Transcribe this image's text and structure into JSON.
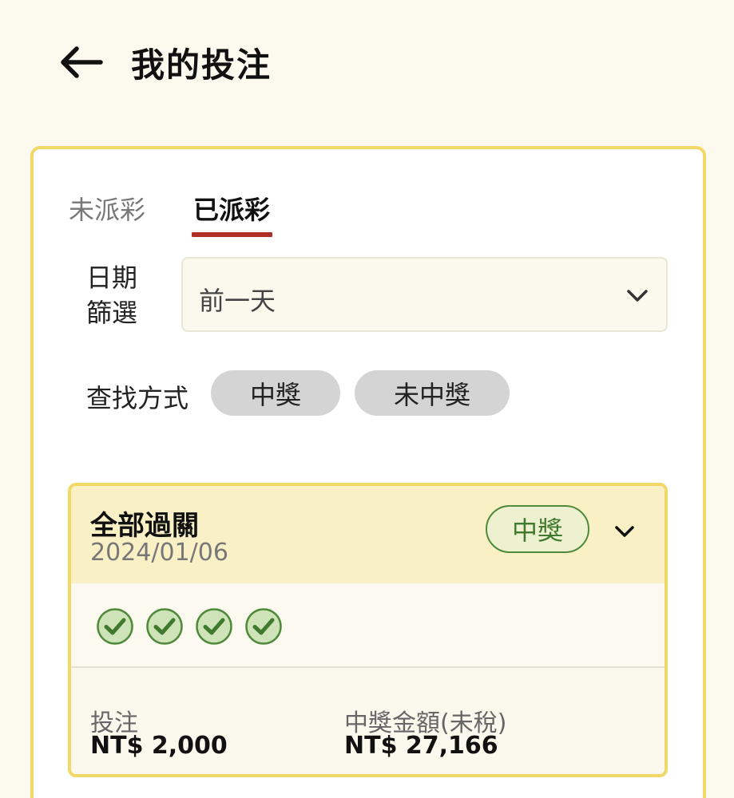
{
  "header": {
    "title": "我的投注",
    "back_icon": "arrow-left-icon"
  },
  "tabs": [
    {
      "label": "未派彩",
      "active": false
    },
    {
      "label": "已派彩",
      "active": true
    }
  ],
  "colors": {
    "accent_yellow": "#f2d867",
    "tab_underline": "#b03028",
    "win_green": "#4f8a3a"
  },
  "filter": {
    "date_label": "日期篩選",
    "date_value": "前一天",
    "search_label": "查找方式",
    "options": [
      "中獎",
      "未中獎"
    ]
  },
  "bet": {
    "type": "全部過關",
    "date": "2024/01/06",
    "status": "中獎",
    "legs": [
      "won",
      "won",
      "won",
      "won"
    ],
    "stake_label": "投注",
    "stake_value": "NT$ 2,000",
    "payout_label": "中獎金額(未稅)",
    "payout_value": "NT$ 27,166"
  }
}
